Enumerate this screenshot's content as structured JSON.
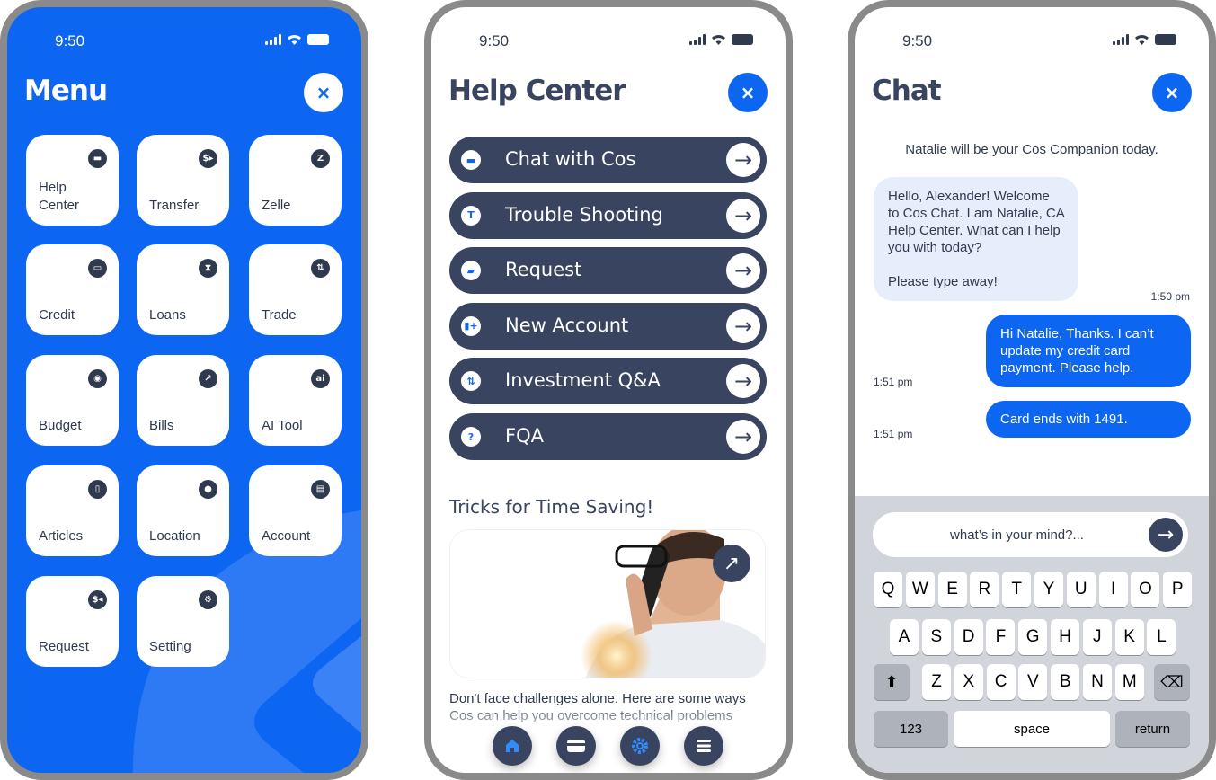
{
  "menu_screen": {
    "time": "9:50",
    "title": "Menu",
    "close": "×",
    "tiles": [
      {
        "label": "Help Center",
        "icon": "chat-icon",
        "glyph": "▬"
      },
      {
        "label": "Transfer",
        "icon": "dollar-transfer-icon",
        "glyph": "$▸"
      },
      {
        "label": "Zelle",
        "icon": "zelle-icon",
        "glyph": "Z"
      },
      {
        "label": "Credit",
        "icon": "credit-card-icon",
        "glyph": "▭"
      },
      {
        "label": "Loans",
        "icon": "hourglass-icon",
        "glyph": "⧗"
      },
      {
        "label": "Trade",
        "icon": "chart-icon",
        "glyph": "⇅"
      },
      {
        "label": "Budget",
        "icon": "donut-chart-icon",
        "glyph": "◉"
      },
      {
        "label": "Bills",
        "icon": "bill-icon",
        "glyph": "↗"
      },
      {
        "label": "AI Tool",
        "icon": "ai-icon",
        "glyph": "ai"
      },
      {
        "label": "Articles",
        "icon": "book-icon",
        "glyph": "▯"
      },
      {
        "label": "Location",
        "icon": "location-pin-icon",
        "glyph": "●"
      },
      {
        "label": "Account",
        "icon": "account-ledger-icon",
        "glyph": "▤"
      },
      {
        "label": "Request",
        "icon": "dollar-request-icon",
        "glyph": "$◂"
      },
      {
        "label": "Setting",
        "icon": "gear-icon",
        "glyph": "⚙"
      }
    ]
  },
  "help_screen": {
    "time": "9:50",
    "title": "Help Center",
    "close": "×",
    "options": [
      {
        "label": "Chat with Cos",
        "icon": "chat-icon",
        "glyph": "▬"
      },
      {
        "label": "Trouble Shooting",
        "icon": "trouble-shooting-icon",
        "glyph": "T"
      },
      {
        "label": "Request",
        "icon": "request-icon",
        "glyph": "▰"
      },
      {
        "label": "New Account",
        "icon": "new-account-icon",
        "glyph": "▮+"
      },
      {
        "label": "Investment Q&A",
        "icon": "investment-icon",
        "glyph": "⇅"
      },
      {
        "label": "FQA",
        "icon": "question-icon",
        "glyph": "?"
      }
    ],
    "arrow": "→",
    "tricks_title": "Tricks for Time Saving!",
    "tricks_link": "↗",
    "tricks_desc": "Don't face challenges alone. Here are some ways Cos can help you overcome technical problems",
    "nav": [
      "home-icon",
      "card-icon",
      "gear-icon",
      "menu-icon"
    ]
  },
  "chat_screen": {
    "time": "9:50",
    "title": "Chat",
    "close": "×",
    "system_message": "Natalie will be your Cos Companion today.",
    "messages": [
      {
        "from": "agent",
        "text": "Hello, Alexander! Welcome to Cos Chat. I am Natalie, CA Help Center. What can I help you with today?",
        "text2": "Please type away!",
        "time": "1:50 pm"
      },
      {
        "from": "user",
        "text": "Hi Natalie, Thanks. I can’t update my credit card payment. Please help.",
        "time": "1:51 pm"
      },
      {
        "from": "user",
        "text": "Card ends with 1491.",
        "time": "1:51 pm"
      }
    ],
    "input_placeholder": "what’s in your mind?...",
    "send": "→",
    "keyboard": {
      "row1": [
        "Q",
        "W",
        "E",
        "R",
        "T",
        "Y",
        "U",
        "I",
        "O",
        "P"
      ],
      "row2": [
        "A",
        "S",
        "D",
        "F",
        "G",
        "H",
        "J",
        "K",
        "L"
      ],
      "row3": [
        "Z",
        "X",
        "C",
        "V",
        "B",
        "N",
        "M"
      ],
      "shift": "⬆",
      "backspace": "⌫",
      "numbers": "123",
      "space": "space",
      "return": "return"
    }
  },
  "colors": {
    "brand_blue": "#0d66f2",
    "navy": "#394560",
    "bubble_in": "#e7eefb",
    "keyboard_bg": "#d1d4db"
  }
}
